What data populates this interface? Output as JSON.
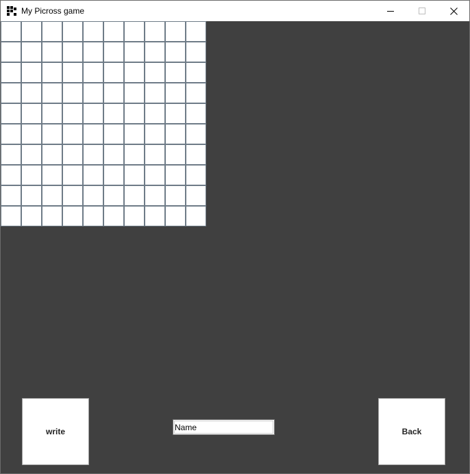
{
  "window": {
    "title": "My Picross game",
    "icon": "picross-app-icon",
    "controls": {
      "minimize_icon": "minimize-icon",
      "maximize_icon": "maximize-icon",
      "close_icon": "close-icon"
    }
  },
  "board": {
    "rows": 10,
    "columns": 10,
    "cell_color": "#ffffff",
    "line_color": "#6e7b87"
  },
  "footer": {
    "write_label": "write",
    "name_value": "Name",
    "back_label": "Back"
  },
  "colors": {
    "background": "#404040",
    "titlebar": "#ffffff"
  }
}
